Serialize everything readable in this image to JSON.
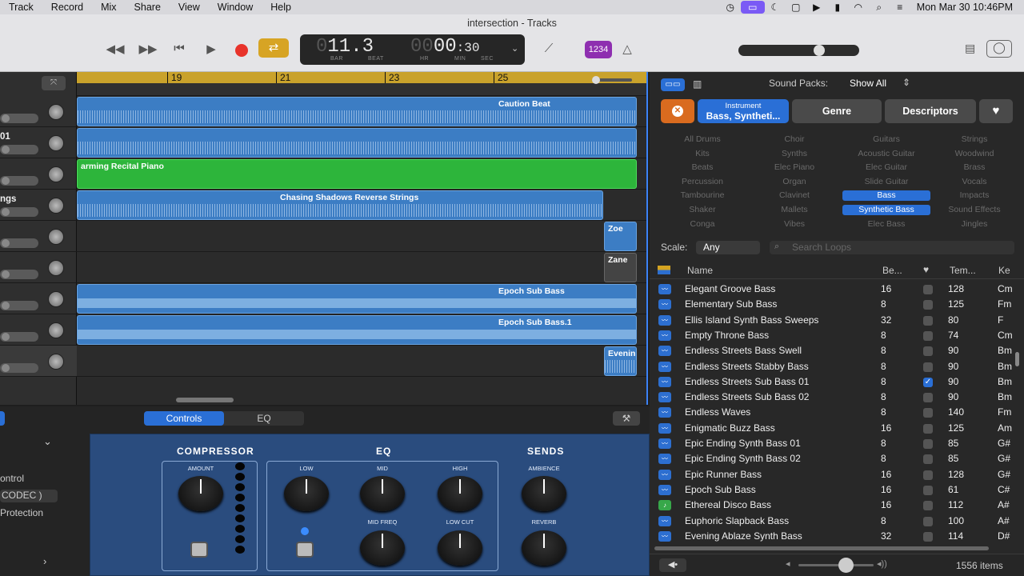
{
  "menubar": {
    "items": [
      "Track",
      "Record",
      "Mix",
      "Share",
      "View",
      "Window",
      "Help"
    ],
    "clock": "Mon Mar 30  10:46PM"
  },
  "window": {
    "title": "intersection - Tracks"
  },
  "lcd": {
    "bar_dim": "0",
    "bar": "11.3",
    "beat_dim": "",
    "hr_dim": "00",
    "min": "00",
    "sec": ":30",
    "lbl_bar": "BAR",
    "lbl_beat": "BEAT",
    "lbl_hr": "HR",
    "lbl_min": "MIN",
    "lbl_sec": "SEC"
  },
  "count_in": "1234",
  "ruler": {
    "marks": [
      "19",
      "21",
      "23",
      "25"
    ]
  },
  "track_headers": [
    "",
    "01",
    "",
    "ngs",
    "",
    "",
    "",
    "",
    ""
  ],
  "regions": {
    "caution": "Caution Beat",
    "piano": "arming Recital Piano",
    "chasing": "Chasing Shadows Reverse Strings",
    "zoe": "Zoe",
    "zane": "Zane",
    "epoch1": "Epoch Sub Bass",
    "epoch2": "Epoch Sub Bass.1",
    "evening": "Evenin"
  },
  "bottom": {
    "tab_controls": "Controls",
    "tab_eq": "EQ",
    "left_control": "ontrol",
    "left_codec": "CODEC )",
    "left_protection": "Protection"
  },
  "plugin": {
    "compressor": "COMPRESSOR",
    "eq": "EQ",
    "sends": "SENDS",
    "amount": "AMOUNT",
    "low": "LOW",
    "mid": "MID",
    "high": "HIGH",
    "ambience": "AMBIENCE",
    "mid_freq": "MID FREQ",
    "low_cut": "LOW CUT",
    "reverb": "REVERB"
  },
  "browser": {
    "sound_packs_label": "Sound Packs:",
    "sound_packs_value": "Show All",
    "instrument_label": "Instrument",
    "instrument_value": "Bass, Syntheti...",
    "genre": "Genre",
    "descriptors": "Descriptors",
    "scale_label": "Scale:",
    "scale_value": "Any",
    "search_placeholder": "Search Loops",
    "col_name": "Name",
    "col_beats": "Be...",
    "col_tempo": "Tem...",
    "col_key": "Ke",
    "item_count": "1556 items"
  },
  "categories": [
    [
      "All Drums",
      "Choir",
      "Guitars",
      "Strings"
    ],
    [
      "Kits",
      "Synths",
      "Acoustic Guitar",
      "Woodwind"
    ],
    [
      "Beats",
      "Elec Piano",
      "Elec Guitar",
      "Brass"
    ],
    [
      "Percussion",
      "Organ",
      "Slide Guitar",
      "Vocals"
    ],
    [
      "Tambourine",
      "Clavinet",
      "Bass",
      "Impacts"
    ],
    [
      "Shaker",
      "Mallets",
      "Synthetic Bass",
      "Sound Effects"
    ],
    [
      "Conga",
      "Vibes",
      "Elec Bass",
      "Jingles"
    ]
  ],
  "selected_categories": [
    "Bass",
    "Synthetic Bass"
  ],
  "loops": [
    {
      "name": "Elegant Groove Bass",
      "beats": "16",
      "fav": false,
      "tempo": "128",
      "key": "Cm",
      "green": false
    },
    {
      "name": "Elementary Sub Bass",
      "beats": "8",
      "fav": false,
      "tempo": "125",
      "key": "Fm",
      "green": false
    },
    {
      "name": "Ellis Island Synth Bass Sweeps",
      "beats": "32",
      "fav": false,
      "tempo": "80",
      "key": "F",
      "green": false
    },
    {
      "name": "Empty Throne Bass",
      "beats": "8",
      "fav": false,
      "tempo": "74",
      "key": "Cm",
      "green": false
    },
    {
      "name": "Endless Streets Bass Swell",
      "beats": "8",
      "fav": false,
      "tempo": "90",
      "key": "Bm",
      "green": false
    },
    {
      "name": "Endless Streets Stabby Bass",
      "beats": "8",
      "fav": false,
      "tempo": "90",
      "key": "Bm",
      "green": false
    },
    {
      "name": "Endless Streets Sub Bass 01",
      "beats": "8",
      "fav": true,
      "tempo": "90",
      "key": "Bm",
      "green": false
    },
    {
      "name": "Endless Streets Sub Bass 02",
      "beats": "8",
      "fav": false,
      "tempo": "90",
      "key": "Bm",
      "green": false
    },
    {
      "name": "Endless Waves",
      "beats": "8",
      "fav": false,
      "tempo": "140",
      "key": "Fm",
      "green": false
    },
    {
      "name": "Enigmatic Buzz Bass",
      "beats": "16",
      "fav": false,
      "tempo": "125",
      "key": "Am",
      "green": false
    },
    {
      "name": "Epic Ending Synth Bass 01",
      "beats": "8",
      "fav": false,
      "tempo": "85",
      "key": "G#",
      "green": false
    },
    {
      "name": "Epic Ending Synth Bass 02",
      "beats": "8",
      "fav": false,
      "tempo": "85",
      "key": "G#",
      "green": false
    },
    {
      "name": "Epic Runner Bass",
      "beats": "16",
      "fav": false,
      "tempo": "128",
      "key": "G#",
      "green": false
    },
    {
      "name": "Epoch Sub Bass",
      "beats": "16",
      "fav": false,
      "tempo": "61",
      "key": "C#",
      "green": false
    },
    {
      "name": "Ethereal Disco Bass",
      "beats": "16",
      "fav": false,
      "tempo": "112",
      "key": "A#",
      "green": true
    },
    {
      "name": "Euphoric Slapback Bass",
      "beats": "8",
      "fav": false,
      "tempo": "100",
      "key": "A#",
      "green": false
    },
    {
      "name": "Evening Ablaze Synth Bass",
      "beats": "32",
      "fav": false,
      "tempo": "114",
      "key": "D#",
      "green": false
    }
  ],
  "colors": {
    "accent": "#2a6fd6",
    "region_blue": "#3c7dc4",
    "region_green": "#2db53b",
    "cycle": "#c9a22b"
  }
}
